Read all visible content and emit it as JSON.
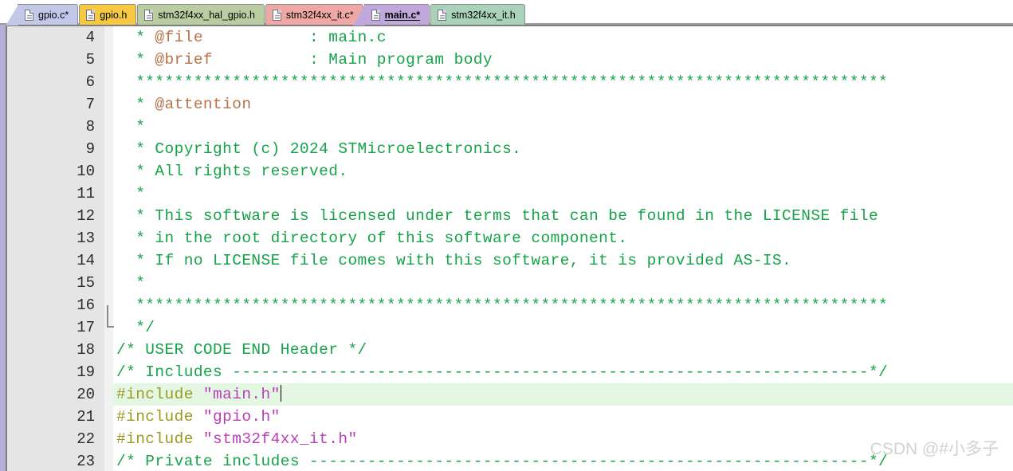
{
  "tabbar": {
    "tabs": [
      {
        "label": "gpio.c*",
        "color": "#c3c8e8",
        "active": false,
        "icon": "file-icon"
      },
      {
        "label": "gpio.h",
        "color": "#f7c842",
        "active": false,
        "icon": "file-icon"
      },
      {
        "label": "stm32f4xx_hal_gpio.h",
        "color": "#b9cda0",
        "active": false,
        "icon": "file-icon"
      },
      {
        "label": "stm32f4xx_it.c*",
        "color": "#f0a8a4",
        "active": false,
        "icon": "file-icon"
      },
      {
        "label": "main.c*",
        "color": "#c0a8dd",
        "active": true,
        "icon": "file-icon"
      },
      {
        "label": "stm32f4xx_it.h",
        "color": "#a8d3b8",
        "active": false,
        "icon": "file-icon"
      }
    ]
  },
  "editor": {
    "accent_color": "#b6aed6",
    "highlight_color": "#e3f7e3",
    "gutter_color": "#e5e5e5",
    "comment_color": "#16a34a",
    "tag_color": "#b8734a",
    "preprocessor_color": "#9a9a23",
    "string_color": "#b83fb8",
    "current_line": 20,
    "lines": [
      {
        "n": "4",
        "segments": [
          {
            "t": "  * ",
            "c": "cmt"
          },
          {
            "t": "@file",
            "c": "tag"
          },
          {
            "t": "           : main.c",
            "c": "cmt"
          }
        ]
      },
      {
        "n": "5",
        "segments": [
          {
            "t": "  * ",
            "c": "cmt"
          },
          {
            "t": "@brief",
            "c": "tag"
          },
          {
            "t": "          : Main program body",
            "c": "cmt"
          }
        ]
      },
      {
        "n": "6",
        "segments": [
          {
            "t": "  ******************************************************************************",
            "c": "cmt"
          }
        ]
      },
      {
        "n": "7",
        "segments": [
          {
            "t": "  * ",
            "c": "cmt"
          },
          {
            "t": "@attention",
            "c": "tag"
          }
        ]
      },
      {
        "n": "8",
        "segments": [
          {
            "t": "  *",
            "c": "cmt"
          }
        ]
      },
      {
        "n": "9",
        "segments": [
          {
            "t": "  * Copyright (c) 2024 STMicroelectronics.",
            "c": "cmt"
          }
        ]
      },
      {
        "n": "10",
        "segments": [
          {
            "t": "  * All rights reserved.",
            "c": "cmt"
          }
        ]
      },
      {
        "n": "11",
        "segments": [
          {
            "t": "  *",
            "c": "cmt"
          }
        ]
      },
      {
        "n": "12",
        "segments": [
          {
            "t": "  * This software is licensed under terms that can be found in the LICENSE file",
            "c": "cmt"
          }
        ]
      },
      {
        "n": "13",
        "segments": [
          {
            "t": "  * in the root directory of this software component.",
            "c": "cmt"
          }
        ]
      },
      {
        "n": "14",
        "segments": [
          {
            "t": "  * If no LICENSE file comes with this software, it is provided AS-IS.",
            "c": "cmt"
          }
        ]
      },
      {
        "n": "15",
        "segments": [
          {
            "t": "  *",
            "c": "cmt"
          }
        ]
      },
      {
        "n": "16",
        "segments": [
          {
            "t": "  ******************************************************************************",
            "c": "cmt"
          }
        ]
      },
      {
        "n": "17",
        "segments": [
          {
            "t": "  */",
            "c": "cmt"
          }
        ],
        "fold_end": true
      },
      {
        "n": "18",
        "segments": [
          {
            "t": "/* USER CODE END Header */",
            "c": "cmt"
          }
        ]
      },
      {
        "n": "19",
        "segments": [
          {
            "t": "/* Includes ------------------------------------------------------------------*/",
            "c": "cmt"
          }
        ]
      },
      {
        "n": "20",
        "segments": [
          {
            "t": "#include ",
            "c": "pp"
          },
          {
            "t": "\"main.h\"",
            "c": "str"
          }
        ],
        "caret": true
      },
      {
        "n": "21",
        "segments": [
          {
            "t": "#include ",
            "c": "pp"
          },
          {
            "t": "\"gpio.h\"",
            "c": "str"
          }
        ]
      },
      {
        "n": "22",
        "segments": [
          {
            "t": "#include ",
            "c": "pp"
          },
          {
            "t": "\"stm32f4xx_it.h\"",
            "c": "str"
          }
        ]
      },
      {
        "n": "23",
        "segments": [
          {
            "t": "/* Private includes ----------------------------------------------------------*/",
            "c": "cmt"
          }
        ]
      }
    ]
  },
  "watermark": {
    "text": "CSDN @#小多子"
  }
}
